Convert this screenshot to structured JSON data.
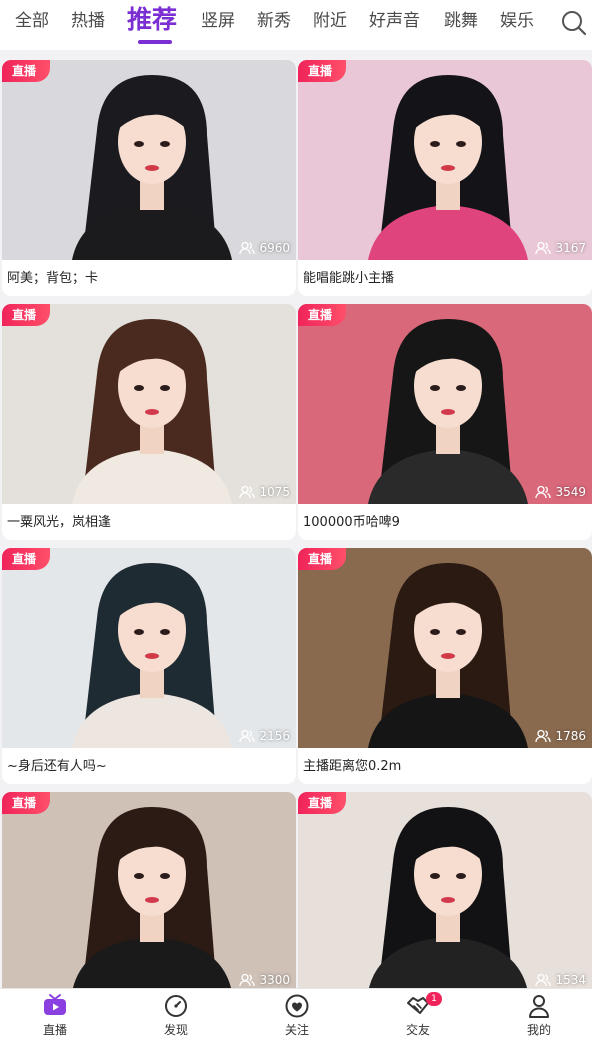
{
  "top_tabs": [
    {
      "label": "全部"
    },
    {
      "label": "热播"
    },
    {
      "label": "推荐",
      "active": true
    },
    {
      "label": "竖屏"
    },
    {
      "label": "新秀"
    },
    {
      "label": "附近"
    },
    {
      "label": "好声音"
    },
    {
      "label": "跳舞"
    },
    {
      "label": "娱乐"
    }
  ],
  "search": {
    "icon": "search-icon"
  },
  "live_badge_label": "直播",
  "cards": [
    {
      "title": "阿美；背包；卡",
      "viewers": "6960",
      "bg": "#d9d9dd",
      "hair": "#1a1a1f",
      "outfit": "#1b1b1d"
    },
    {
      "title": "能唱能跳小主播",
      "viewers": "3167",
      "bg": "#e9c7d6",
      "hair": "#141418",
      "outfit": "#e0447c"
    },
    {
      "title": "一粟风光，岚相逢",
      "viewers": "1075",
      "bg": "#e4e1dc",
      "hair": "#4a2a1e",
      "outfit": "#efe9e2"
    },
    {
      "title": "100000币哈啤9",
      "viewers": "3549",
      "bg": "#d9687a",
      "hair": "#161616",
      "outfit": "#2a2a2a"
    },
    {
      "title": "~身后还有人吗~",
      "viewers": "2156",
      "bg": "#e3e7ea",
      "hair": "#1f2b33",
      "outfit": "#ece5e0"
    },
    {
      "title": "主播距离您0.2m",
      "viewers": "1786",
      "bg": "#8a6a4f",
      "hair": "#2a1a12",
      "outfit": "#151515"
    },
    {
      "title": "",
      "viewers": "3300",
      "bg": "#cfc1b6",
      "hair": "#2b1b14",
      "outfit": "#1a1a1a"
    },
    {
      "title": "",
      "viewers": "1534",
      "bg": "#e7dfda",
      "hair": "#121214",
      "outfit": "#222"
    }
  ],
  "bottom_nav": [
    {
      "label": "直播",
      "icon": "tv-icon",
      "active": true
    },
    {
      "label": "发现",
      "icon": "compass-icon"
    },
    {
      "label": "关注",
      "icon": "heart-icon"
    },
    {
      "label": "交友",
      "icon": "handshake-icon",
      "badge": "1"
    },
    {
      "label": "我的",
      "icon": "person-icon"
    }
  ],
  "colors": {
    "accent": "#7b2fd2",
    "live_badge": "#f0245a",
    "background": "#f2f2f4"
  }
}
